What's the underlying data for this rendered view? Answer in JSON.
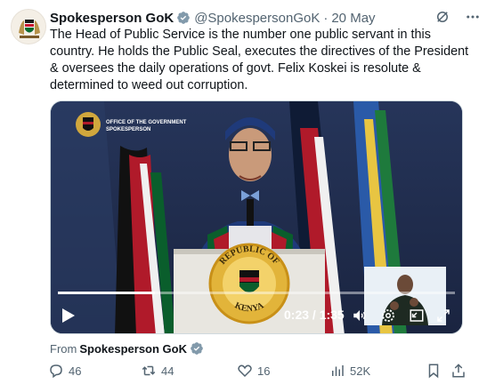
{
  "tweet": {
    "author_name": "Spokesperson GoK",
    "author_handle": "@SpokespersonGoK",
    "separator": "·",
    "date": "20 May",
    "text": "The Head of Public Service is the number one public servant in this country. He holds the Public Seal, executes the directives of the President & oversees the daily operations of govt. Felix Koskei is resolute & determined to weed out corruption."
  },
  "video": {
    "watermark_line1": "OFFICE OF THE GOVERNMENT",
    "watermark_line2": "SPOKESPERSON",
    "podium_text_top": "REPUBLIC OF",
    "podium_text_bottom": "KENYA",
    "time": "0:23 / 1:35",
    "progress_fraction": 0.245
  },
  "source": {
    "prefix": "From",
    "name": "Spokesperson GoK"
  },
  "actions": {
    "replies": "46",
    "reposts": "44",
    "likes": "16",
    "views": "52K"
  },
  "colors": {
    "verified": "#829aab",
    "muted": "#536471",
    "text": "#0f1419"
  }
}
